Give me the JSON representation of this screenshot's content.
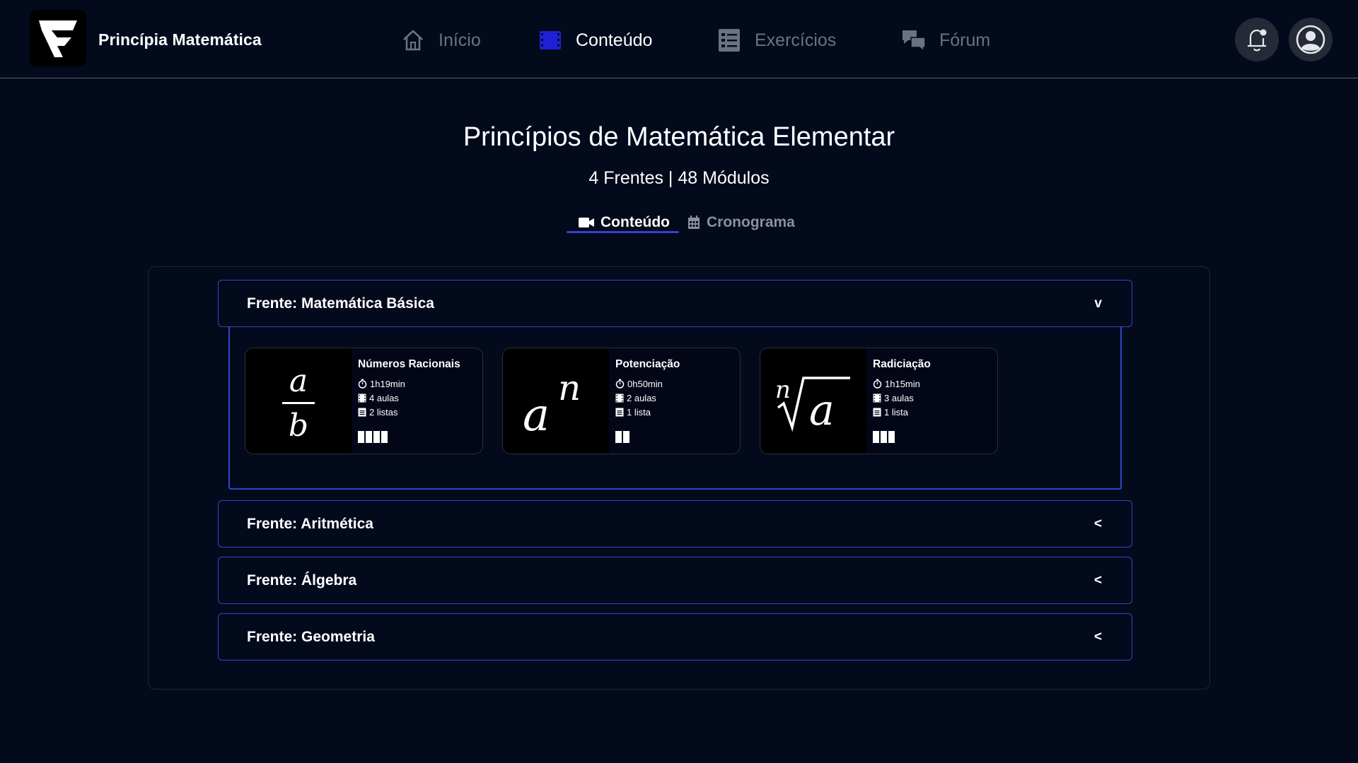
{
  "brand": {
    "name": "Princípia Matemática"
  },
  "nav": {
    "items": [
      {
        "label": "Início",
        "icon": "home-icon",
        "active": false
      },
      {
        "label": "Conteúdo",
        "icon": "film-icon",
        "active": true
      },
      {
        "label": "Exercícios",
        "icon": "checklist-icon",
        "active": false
      },
      {
        "label": "Fórum",
        "icon": "chat-bubbles-icon",
        "active": false
      }
    ],
    "notification_icon": "bell-icon",
    "profile_icon": "user-circle-icon"
  },
  "course": {
    "title": "Princípios de Matemática Elementar",
    "subtitle": "4 Frentes | 48 Módulos"
  },
  "tabs": [
    {
      "label": "Conteúdo",
      "icon": "video-camera-icon",
      "active": true
    },
    {
      "label": "Cronograma",
      "icon": "calendar-icon",
      "active": false
    }
  ],
  "frentes": [
    {
      "title": "Frente: Matemática Básica",
      "chevron": "v",
      "expanded": true,
      "modules": [
        {
          "title": "Números Racionais",
          "duration": "1h19min",
          "lessons": "4 aulas",
          "lists": "2 listas",
          "progress_segments": 4,
          "formula": "a/b"
        },
        {
          "title": "Potenciação",
          "duration": "0h50min",
          "lessons": "2 aulas",
          "lists": "1 lista",
          "progress_segments": 2,
          "formula": "a^n"
        },
        {
          "title": "Radiciação",
          "duration": "1h15min",
          "lessons": "3 aulas",
          "lists": "1 lista",
          "progress_segments": 3,
          "formula": "n-th root of a"
        }
      ]
    },
    {
      "title": "Frente: Aritmética",
      "chevron": "<",
      "expanded": false
    },
    {
      "title": "Frente: Álgebra",
      "chevron": "<",
      "expanded": false
    },
    {
      "title": "Frente: Geometria",
      "chevron": "<",
      "expanded": false
    }
  ],
  "colors": {
    "background": "#030a1c",
    "accent": "#3b42c4",
    "nav_active_icon": "#1f1fd6",
    "muted_text": "#6b7280"
  }
}
